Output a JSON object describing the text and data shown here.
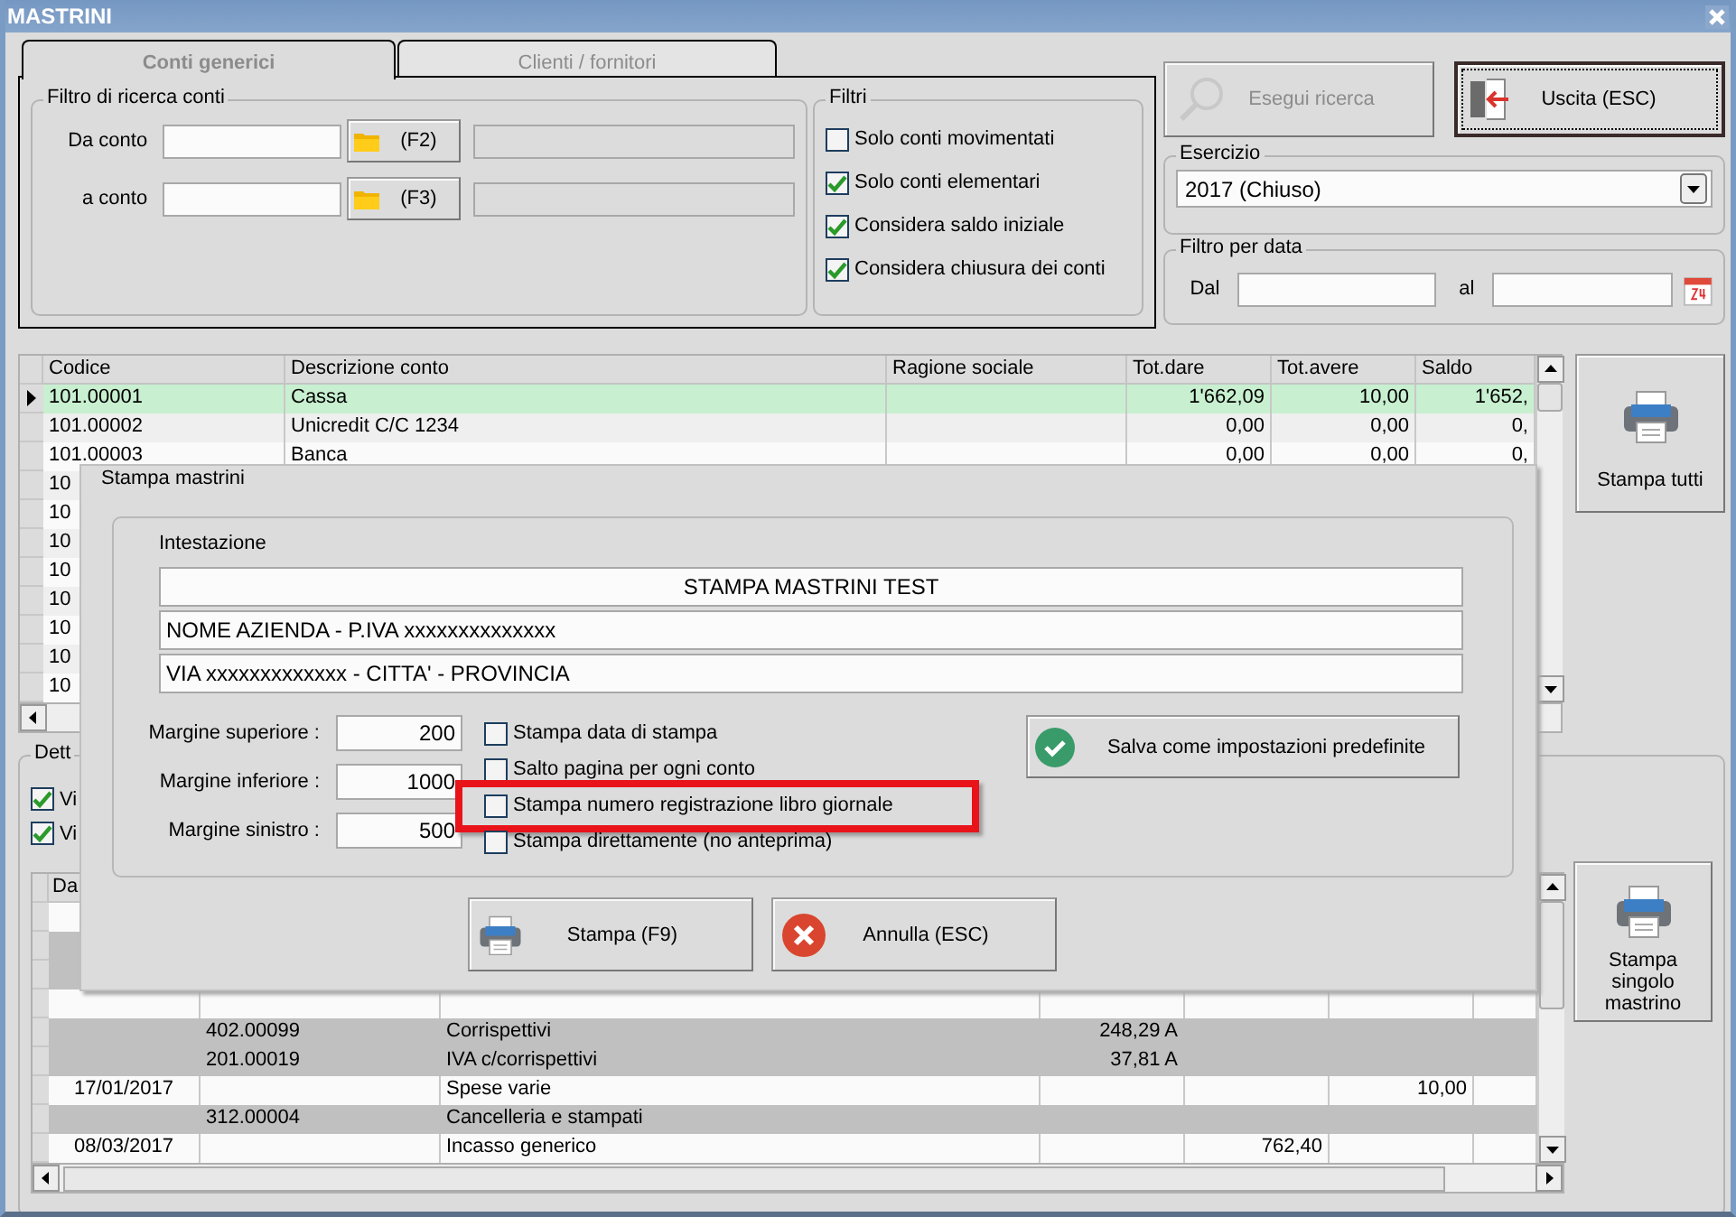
{
  "window": {
    "title": "MASTRINI"
  },
  "tabs": [
    {
      "label": "Conti generici",
      "selected": true
    },
    {
      "label": "Clienti / fornitori",
      "selected": false
    }
  ],
  "account_filter": {
    "title": "Filtro di ricerca conti",
    "rows": [
      {
        "label": "Da conto",
        "button": "(F2)"
      },
      {
        "label": "a conto",
        "button": "(F3)"
      }
    ]
  },
  "filters": {
    "title": "Filtri",
    "options": [
      {
        "label": "Solo conti movimentati",
        "checked": false
      },
      {
        "label": "Solo conti elementari",
        "checked": true
      },
      {
        "label": "Considera saldo iniziale",
        "checked": true
      },
      {
        "label": "Considera chiusura dei conti",
        "checked": true
      }
    ]
  },
  "search_button": {
    "label": "Esegui ricerca",
    "disabled": true
  },
  "exit_button": {
    "label": "Uscita (ESC)"
  },
  "fiscal_year": {
    "title": "Esercizio",
    "value": "2017 (Chiuso)"
  },
  "date_filter": {
    "title": "Filtro per data",
    "from_label": "Dal",
    "to_label": "al"
  },
  "accounts_table": {
    "columns": [
      "Codice",
      "Descrizione conto",
      "Ragione sociale",
      "Tot.dare",
      "Tot.avere",
      "Saldo"
    ],
    "rows": [
      {
        "selected": true,
        "cells": [
          "101.00001",
          "Cassa",
          "",
          "1'662,09",
          "10,00",
          "1'652,"
        ]
      },
      {
        "selected": false,
        "cells": [
          "101.00002",
          "Unicredit C/C 1234",
          "",
          "0,00",
          "0,00",
          "0,"
        ]
      },
      {
        "selected": false,
        "cells": [
          "101.00003",
          "Banca",
          "",
          "0,00",
          "0,00",
          "0,"
        ]
      },
      {
        "selected": false,
        "cells": [
          "10"
        ]
      },
      {
        "selected": false,
        "cells": [
          "10"
        ]
      },
      {
        "selected": false,
        "cells": [
          "10"
        ]
      },
      {
        "selected": false,
        "cells": [
          "10"
        ]
      },
      {
        "selected": false,
        "cells": [
          "10"
        ]
      },
      {
        "selected": false,
        "cells": [
          "10"
        ]
      },
      {
        "selected": false,
        "cells": [
          "10"
        ]
      },
      {
        "selected": false,
        "cells": [
          "10"
        ]
      }
    ]
  },
  "print_all_button": {
    "label": "Stampa tutti"
  },
  "detail": {
    "title": "Dett",
    "options": [
      {
        "label": "Vi",
        "checked": true
      },
      {
        "label": "Vi",
        "checked": true
      }
    ],
    "table": {
      "columns": [
        "Da"
      ],
      "rows": [
        {
          "kind": "movement"
        },
        {
          "kind": "line"
        },
        {
          "kind": "line"
        },
        {
          "kind": "movement"
        },
        {
          "kind": "line",
          "column_2": "402.00099",
          "column_3": "Corrispettivi",
          "column_4": "248,29 A"
        },
        {
          "kind": "line",
          "column_2": "201.00019",
          "column_3": "IVA c/corrispettivi",
          "column_4": "37,81 A"
        },
        {
          "kind": "movement",
          "column_1": "17/01/2017",
          "column_3": "Spese varie",
          "column_6": "10,00"
        },
        {
          "kind": "line",
          "column_2": "312.00004",
          "column_3": "Cancelleria e stampati"
        },
        {
          "kind": "movement",
          "column_1": "08/03/2017",
          "column_3": "Incasso generico",
          "column_5": "762,40"
        }
      ]
    }
  },
  "print_single_button": {
    "label": "Stampa singolo mastrino"
  },
  "dialog": {
    "title": "Stampa mastrini",
    "header_title": "Intestazione",
    "header_lines": [
      "STAMPA MASTRINI TEST",
      "NOME AZIENDA - P.IVA xxxxxxxxxxxxxx",
      "VIA xxxxxxxxxxxxx - CITTA' - PROVINCIA"
    ],
    "margins": [
      {
        "label": "Margine superiore :",
        "value": "200"
      },
      {
        "label": "Margine inferiore :",
        "value": "1000"
      },
      {
        "label": "Margine sinistro :",
        "value": "500"
      }
    ],
    "options": [
      {
        "label": "Stampa data di stampa",
        "checked": false,
        "highlighted": false
      },
      {
        "label": "Salto pagina per ogni conto",
        "checked": false,
        "highlighted": false
      },
      {
        "label": "Stampa numero registrazione libro giornale",
        "checked": false,
        "highlighted": true
      },
      {
        "label": "Stampa direttamente (no anteprima)",
        "checked": false,
        "highlighted": false
      }
    ],
    "save_button": "Salva come impostazioni predefinite",
    "print_button": "Stampa (F9)",
    "cancel_button": "Annulla (ESC)"
  }
}
